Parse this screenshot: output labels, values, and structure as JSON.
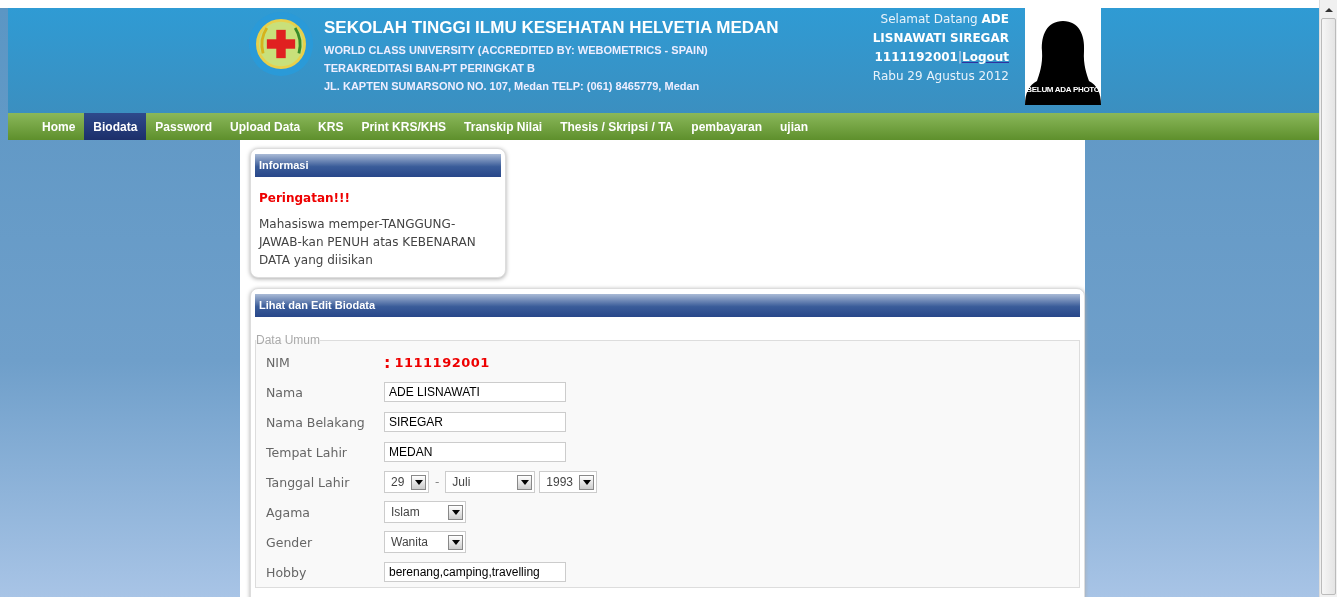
{
  "header": {
    "title": "SEKOLAH TINGGI ILMU KESEHATAN HELVETIA MEDAN",
    "subtitle_lines": [
      "WORLD CLASS UNIVERSITY (ACCREDITED BY: WEBOMETRICS - SPAIN)",
      "TERAKREDITASI BAN-PT PERINGKAT B",
      "JL. KAPTEN SUMARSONO NO. 107, Medan TELP: (061) 8465779, Medan"
    ],
    "greeting": "Selamat Datang",
    "user_name": "ADE LISNAWATI SIREGAR",
    "user_id": "1111192001",
    "separator": "|",
    "logout": "Logout",
    "date": "Rabu 29 Agustus 2012",
    "photo_caption": "BELUM ADA PHOTO"
  },
  "nav": [
    {
      "label": "Home",
      "selected": false
    },
    {
      "label": "Biodata",
      "selected": true
    },
    {
      "label": "Password",
      "selected": false
    },
    {
      "label": "Upload Data",
      "selected": false
    },
    {
      "label": "KRS",
      "selected": false
    },
    {
      "label": "Print KRS/KHS",
      "selected": false
    },
    {
      "label": "Transkip Nilai",
      "selected": false
    },
    {
      "label": "Thesis / Skripsi / TA",
      "selected": false
    },
    {
      "label": "pembayaran",
      "selected": false
    },
    {
      "label": "ujian",
      "selected": false
    }
  ],
  "info_panel": {
    "title": "Informasi",
    "warning": "Peringatan!!!",
    "message": "Mahasiswa memper-TANGGUNG-JAWAB-kan PENUH atas KEBENARAN DATA yang diisikan"
  },
  "biodata_panel": {
    "title": "Lihat dan Edit Biodata",
    "legend": "Data Umum",
    "fields": [
      {
        "kind": "text",
        "label": "NIM",
        "prefix": ":",
        "value": "1111192001"
      },
      {
        "kind": "input",
        "label": "Nama",
        "value": "ADE LISNAWATI"
      },
      {
        "kind": "input",
        "label": "Nama Belakang",
        "value": "SIREGAR"
      },
      {
        "kind": "input",
        "label": "Tempat Lahir",
        "value": "MEDAN"
      },
      {
        "kind": "date",
        "label": "Tanggal Lahir",
        "day": "29",
        "separator": "-",
        "month": "Juli",
        "year": "1993"
      },
      {
        "kind": "select",
        "label": "Agama",
        "value": "Islam"
      },
      {
        "kind": "select",
        "label": "Gender",
        "value": "Wanita"
      },
      {
        "kind": "input",
        "label": "Hobby",
        "value": "berenang,camping,travelling"
      }
    ]
  }
}
